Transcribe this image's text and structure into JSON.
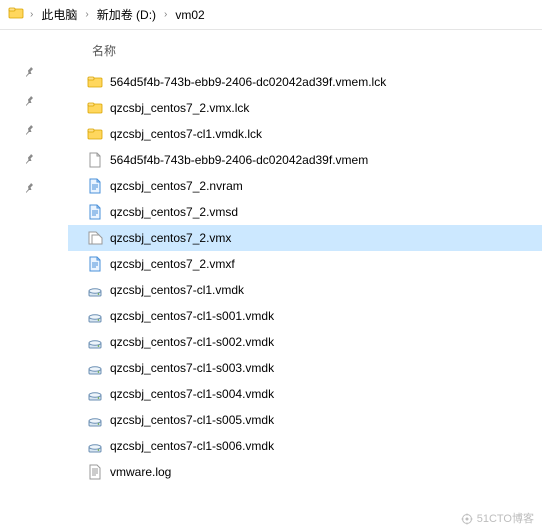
{
  "breadcrumb": {
    "items": [
      "此电脑",
      "新加卷 (D:)",
      "vm02"
    ]
  },
  "columns": {
    "name": "名称"
  },
  "files": [
    {
      "name": "564d5f4b-743b-ebb9-2406-dc02042ad39f.vmem.lck",
      "icon": "folder",
      "selected": false
    },
    {
      "name": "qzcsbj_centos7_2.vmx.lck",
      "icon": "folder",
      "selected": false
    },
    {
      "name": "qzcsbj_centos7-cl1.vmdk.lck",
      "icon": "folder",
      "selected": false
    },
    {
      "name": "564d5f4b-743b-ebb9-2406-dc02042ad39f.vmem",
      "icon": "file",
      "selected": false
    },
    {
      "name": "qzcsbj_centos7_2.nvram",
      "icon": "page",
      "selected": false
    },
    {
      "name": "qzcsbj_centos7_2.vmsd",
      "icon": "page",
      "selected": false
    },
    {
      "name": "qzcsbj_centos7_2.vmx",
      "icon": "vmx",
      "selected": true
    },
    {
      "name": "qzcsbj_centos7_2.vmxf",
      "icon": "page",
      "selected": false
    },
    {
      "name": "qzcsbj_centos7-cl1.vmdk",
      "icon": "disk",
      "selected": false
    },
    {
      "name": "qzcsbj_centos7-cl1-s001.vmdk",
      "icon": "disk",
      "selected": false
    },
    {
      "name": "qzcsbj_centos7-cl1-s002.vmdk",
      "icon": "disk",
      "selected": false
    },
    {
      "name": "qzcsbj_centos7-cl1-s003.vmdk",
      "icon": "disk",
      "selected": false
    },
    {
      "name": "qzcsbj_centos7-cl1-s004.vmdk",
      "icon": "disk",
      "selected": false
    },
    {
      "name": "qzcsbj_centos7-cl1-s005.vmdk",
      "icon": "disk",
      "selected": false
    },
    {
      "name": "qzcsbj_centos7-cl1-s006.vmdk",
      "icon": "disk",
      "selected": false
    },
    {
      "name": "vmware.log",
      "icon": "log",
      "selected": false
    }
  ],
  "quick_pins": 5,
  "watermark": "51CTO博客",
  "icons": {
    "folder": "folder-icon",
    "file": "file-icon",
    "page": "page-icon",
    "vmx": "vmx-icon",
    "disk": "disk-icon",
    "log": "log-icon"
  }
}
